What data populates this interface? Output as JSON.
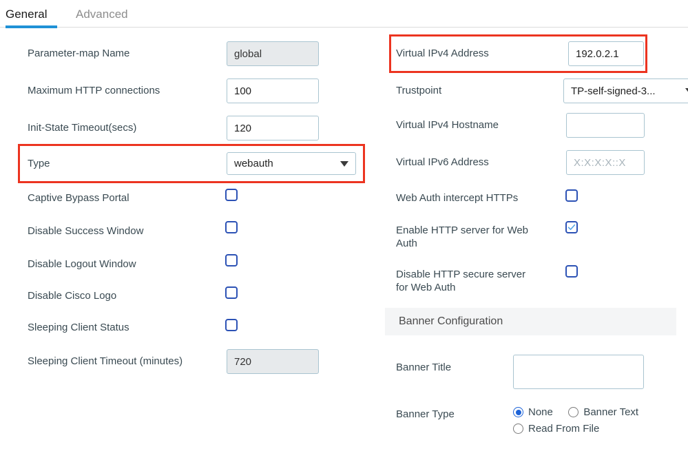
{
  "tabs": [
    {
      "label": "General",
      "active": true
    },
    {
      "label": "Advanced",
      "active": false
    }
  ],
  "colors": {
    "tab_accent": "#1f91d6",
    "highlight_border": "#ec3420",
    "checkbox_border": "#2c52b5",
    "radio_selected": "#1d63d8",
    "input_border": "#a9c4d0",
    "disabled_field_bg": "#e7eaec",
    "section_header_bg": "#f4f5f6"
  },
  "left_column": {
    "parameter_map_name": {
      "label": "Parameter-map Name",
      "value": "global",
      "disabled": true
    },
    "maximum_http_connections": {
      "label": "Maximum HTTP connections",
      "value": "100",
      "disabled": false
    },
    "init_state_timeout": {
      "label": "Init-State Timeout(secs)",
      "value": "120",
      "disabled": false
    },
    "type": {
      "label": "Type",
      "value": "webauth",
      "icon": "chevron-down-icon",
      "highlighted": true
    },
    "checkboxes": [
      {
        "label": "Captive Bypass Portal",
        "checked": false
      },
      {
        "label": "Disable Success Window",
        "checked": false
      },
      {
        "label": "Disable Logout Window",
        "checked": false
      },
      {
        "label": "Disable Cisco Logo",
        "checked": false
      },
      {
        "label": "Sleeping Client Status",
        "checked": false
      }
    ],
    "sleeping_client_timeout": {
      "label": "Sleeping Client Timeout (minutes)",
      "value": "720",
      "disabled": true
    }
  },
  "right_column": {
    "virtual_ipv4_address": {
      "label": "Virtual IPv4 Address",
      "value": "192.0.2.1",
      "highlighted": true
    },
    "trustpoint": {
      "label": "Trustpoint",
      "value": "TP-self-signed-3...",
      "icon": "chevron-down-icon"
    },
    "virtual_ipv4_hostname": {
      "label": "Virtual IPv4 Hostname",
      "value": "",
      "placeholder": ""
    },
    "virtual_ipv6_address": {
      "label": "Virtual IPv6 Address",
      "value": "",
      "placeholder": "X:X:X:X::X"
    },
    "checkboxes": [
      {
        "label": "Web Auth intercept HTTPs",
        "checked": false
      },
      {
        "label": "Enable HTTP server for Web\nAuth",
        "checked": true
      },
      {
        "label": "Disable HTTP secure server\nfor Web Auth",
        "checked": false
      }
    ],
    "banner_section": {
      "title": "Banner Configuration",
      "banner_title": {
        "label": "Banner Title",
        "value": ""
      },
      "banner_type": {
        "label": "Banner Type",
        "options": [
          {
            "label": "None",
            "selected": true
          },
          {
            "label": "Banner Text",
            "selected": false
          },
          {
            "label": "Read From File",
            "selected": false
          }
        ]
      }
    }
  }
}
